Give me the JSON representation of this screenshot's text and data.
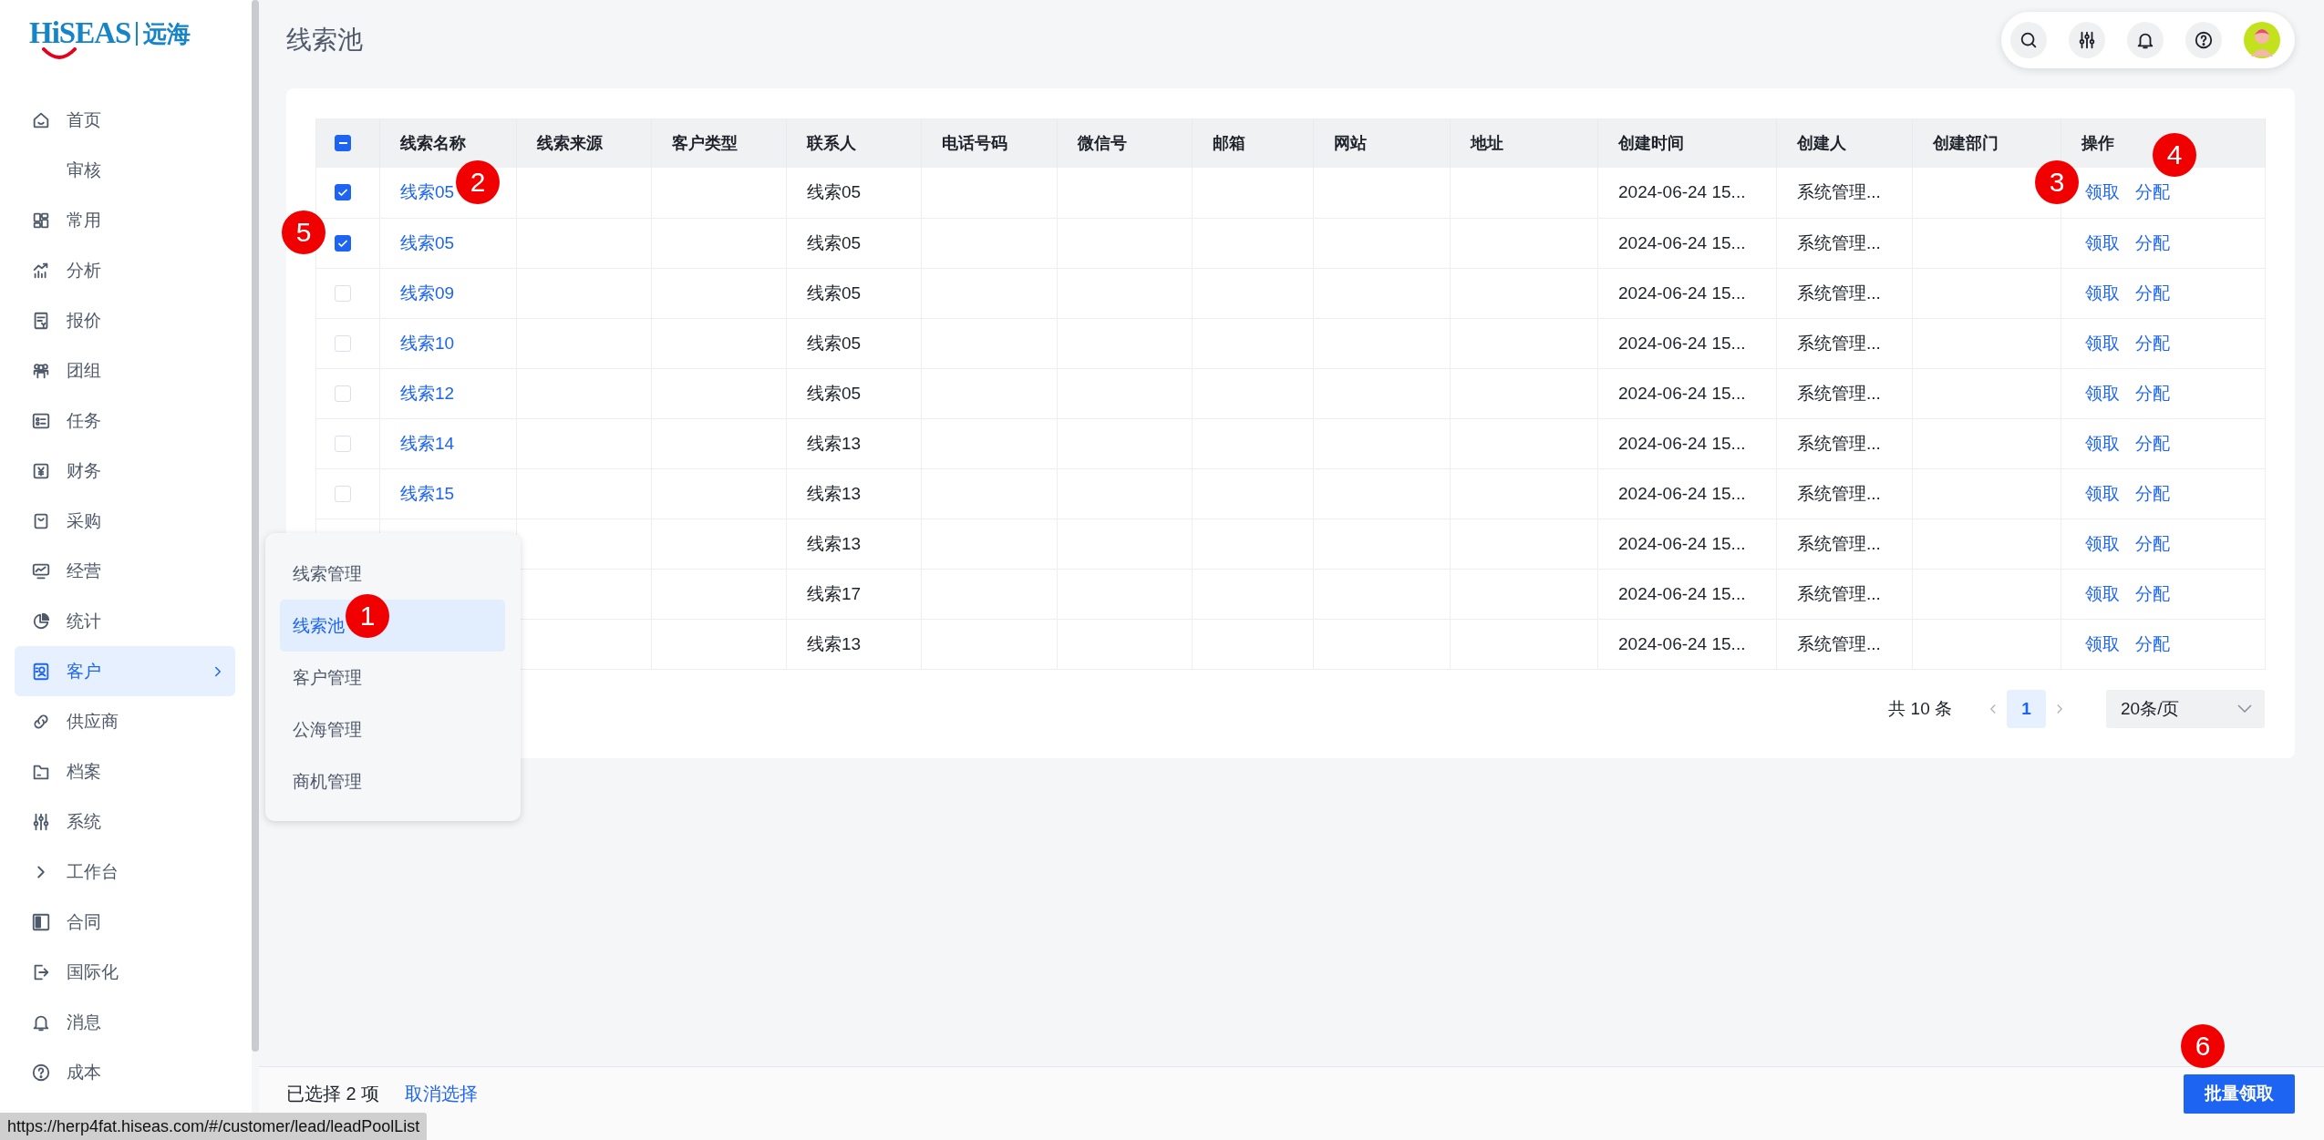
{
  "logo": {
    "brand": "HiSEAS",
    "name": "远海"
  },
  "sidebar": {
    "items": [
      {
        "label": "首页",
        "selected": false
      },
      {
        "label": "审核",
        "selected": false
      },
      {
        "label": "常用",
        "selected": false
      },
      {
        "label": "分析",
        "selected": false
      },
      {
        "label": "报价",
        "selected": false
      },
      {
        "label": "团组",
        "selected": false
      },
      {
        "label": "任务",
        "selected": false
      },
      {
        "label": "财务",
        "selected": false
      },
      {
        "label": "采购",
        "selected": false
      },
      {
        "label": "经营",
        "selected": false
      },
      {
        "label": "统计",
        "selected": false
      },
      {
        "label": "客户",
        "selected": true
      },
      {
        "label": "供应商",
        "selected": false
      },
      {
        "label": "档案",
        "selected": false
      },
      {
        "label": "系统",
        "selected": false
      },
      {
        "label": "工作台",
        "selected": false
      },
      {
        "label": "合同",
        "selected": false
      },
      {
        "label": "国际化",
        "selected": false
      },
      {
        "label": "消息",
        "selected": false
      },
      {
        "label": "成本",
        "selected": false
      }
    ]
  },
  "submenu": {
    "items": [
      {
        "label": "线索管理",
        "selected": false
      },
      {
        "label": "线索池",
        "selected": true
      },
      {
        "label": "客户管理",
        "selected": false
      },
      {
        "label": "公海管理",
        "selected": false
      },
      {
        "label": "商机管理",
        "selected": false
      }
    ]
  },
  "page_title": "线索池",
  "table": {
    "select_all": {
      "indeterminate": true
    },
    "columns": [
      "线索名称",
      "线索来源",
      "客户类型",
      "联系人",
      "电话号码",
      "微信号",
      "邮箱",
      "网站",
      "地址",
      "创建时间",
      "创建人",
      "创建部门",
      "操作"
    ],
    "rows": [
      {
        "checked": true,
        "name": "线索05",
        "contact": "线索05",
        "created_time": "2024-06-24 15...",
        "creator": "系统管理...",
        "actions": [
          "领取",
          "分配"
        ]
      },
      {
        "checked": true,
        "name": "线索05",
        "contact": "线索05",
        "created_time": "2024-06-24 15...",
        "creator": "系统管理...",
        "actions": [
          "领取",
          "分配"
        ]
      },
      {
        "checked": false,
        "name": "线索09",
        "contact": "线索05",
        "created_time": "2024-06-24 15...",
        "creator": "系统管理...",
        "actions": [
          "领取",
          "分配"
        ]
      },
      {
        "checked": false,
        "name": "线索10",
        "contact": "线索05",
        "created_time": "2024-06-24 15...",
        "creator": "系统管理...",
        "actions": [
          "领取",
          "分配"
        ]
      },
      {
        "checked": false,
        "name": "线索12",
        "contact": "线索05",
        "created_time": "2024-06-24 15...",
        "creator": "系统管理...",
        "actions": [
          "领取",
          "分配"
        ]
      },
      {
        "checked": false,
        "name": "线索14",
        "contact": "线索13",
        "created_time": "2024-06-24 15...",
        "creator": "系统管理...",
        "actions": [
          "领取",
          "分配"
        ]
      },
      {
        "checked": false,
        "name": "线索15",
        "contact": "线索13",
        "created_time": "2024-06-24 15...",
        "creator": "系统管理...",
        "actions": [
          "领取",
          "分配"
        ]
      },
      {
        "contact": "线索13",
        "created_time": "2024-06-24 15...",
        "creator": "系统管理...",
        "actions": [
          "领取",
          "分配"
        ]
      },
      {
        "contact": "线索17",
        "created_time": "2024-06-24 15...",
        "creator": "系统管理...",
        "actions": [
          "领取",
          "分配"
        ]
      },
      {
        "contact": "线索13",
        "created_time": "2024-06-24 15...",
        "creator": "系统管理...",
        "actions": [
          "领取",
          "分配"
        ]
      }
    ]
  },
  "pagination": {
    "total": "共 10 条",
    "pages": [
      {
        "label": "1",
        "selected": true
      }
    ],
    "page_size": "20条/页"
  },
  "selection_bar": {
    "summary": "已选择 2 项",
    "clear_link": "取消选择",
    "batch_button": "批量领取"
  },
  "annotations": [
    {
      "label": "1"
    },
    {
      "label": "2"
    },
    {
      "label": "3"
    },
    {
      "label": "4"
    },
    {
      "label": "5"
    },
    {
      "label": "6"
    }
  ],
  "status_url": "https://herp4fat.hiseas.com/#/customer/lead/leadPoolList"
}
